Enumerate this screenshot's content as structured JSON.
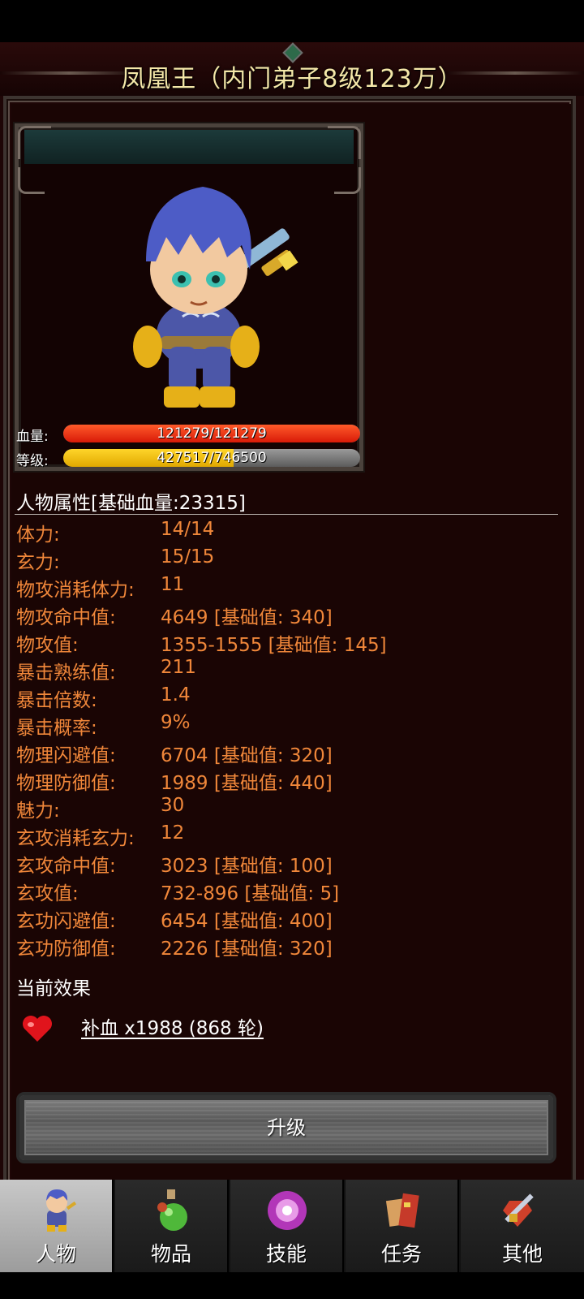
{
  "header": {
    "title": "凤凰王（内门弟子8级123万）"
  },
  "character": {
    "hp_label": "血量:",
    "hp_text": "121279/121279",
    "hp_fraction": 1.0,
    "level_label": "等级:",
    "level_text": "427517/746500",
    "level_fraction": 0.573
  },
  "attributes": {
    "title": "人物属性[基础血量:23315]",
    "rows": [
      {
        "label": "体力:",
        "value": "14/14"
      },
      {
        "label": "玄力:",
        "value": "15/15"
      },
      {
        "label": "物攻消耗体力:",
        "value": "11"
      },
      {
        "label": "物攻命中值:",
        "value": "4649 [基础值: 340]"
      },
      {
        "label": "物攻值:",
        "value": "1355-1555 [基础值: 145]"
      },
      {
        "label": "暴击熟练值:",
        "value": "211"
      },
      {
        "label": "暴击倍数:",
        "value": "1.4"
      },
      {
        "label": "暴击概率:",
        "value": "9%"
      },
      {
        "label": "物理闪避值:",
        "value": "6704 [基础值: 320]"
      },
      {
        "label": "物理防御值:",
        "value": "1989 [基础值: 440]"
      },
      {
        "label": "魅力:",
        "value": "30"
      },
      {
        "label": "玄攻消耗玄力:",
        "value": "12"
      },
      {
        "label": "玄攻命中值:",
        "value": "3023 [基础值: 100]"
      },
      {
        "label": "玄攻值:",
        "value": "732-896 [基础值: 5]"
      },
      {
        "label": "玄功闪避值:",
        "value": "6454 [基础值: 400]"
      },
      {
        "label": "玄功防御值:",
        "value": "2226 [基础值: 320]"
      }
    ]
  },
  "effects": {
    "title": "当前效果",
    "items": [
      {
        "icon": "heart-icon",
        "text": "补血 x1988 (868 轮)"
      }
    ]
  },
  "upgrade_button": {
    "label": "升级"
  },
  "tabs": [
    {
      "label": "人物",
      "icon": "character-icon",
      "active": true
    },
    {
      "label": "物品",
      "icon": "potion-icon",
      "active": false
    },
    {
      "label": "技能",
      "icon": "skill-orb-icon",
      "active": false
    },
    {
      "label": "任务",
      "icon": "quest-scroll-icon",
      "active": false
    },
    {
      "label": "其他",
      "icon": "sword-shield-icon",
      "active": false
    }
  ],
  "colors": {
    "stat_text": "#f0873a",
    "hp_bar": "#e8250f",
    "level_bar": "#f0c000",
    "title_text": "#f4e7a8"
  }
}
